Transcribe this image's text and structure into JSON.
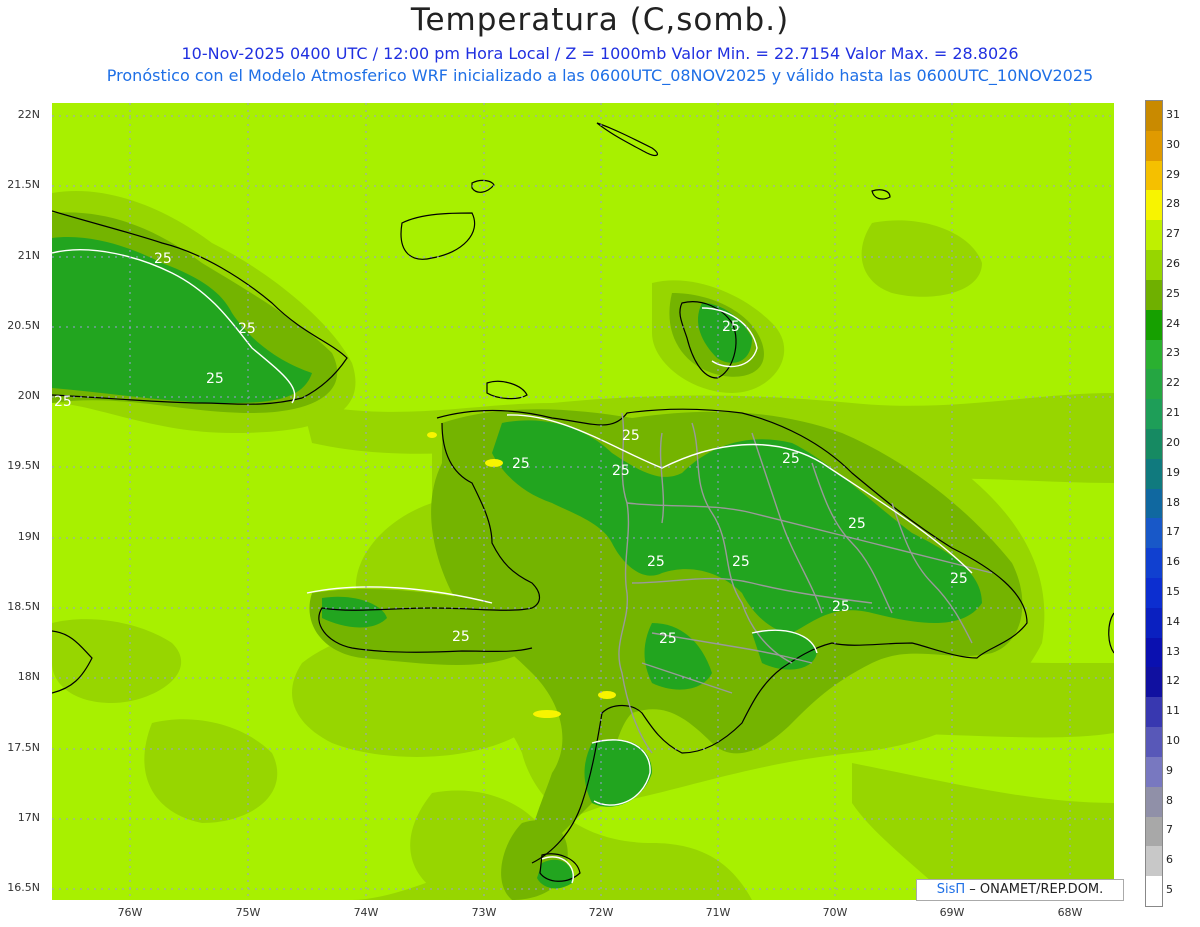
{
  "header": {
    "title": "Temperatura (C,somb.)",
    "subtitle_line1": "10-Nov-2025 0400 UTC / 12:00 pm Hora Local / Z = 1000mb   Valor Min. = 22.7154  Valor Max. = 28.8026",
    "subtitle_line2": "Pronóstico con el Modelo Atmosferico WRF inicializado a las 0600UTC_08NOV2025 y válido hasta las  0600UTC_10NOV2025"
  },
  "axes": {
    "lat_labels": [
      "22N",
      "21.5N",
      "21N",
      "20.5N",
      "20N",
      "19.5N",
      "19N",
      "18.5N",
      "18N",
      "17.5N",
      "17N",
      "16.5N"
    ],
    "lon_labels": [
      "76W",
      "75W",
      "74W",
      "73W",
      "72W",
      "71W",
      "70W",
      "69W",
      "68W"
    ]
  },
  "legend": {
    "values": [
      "31",
      "30",
      "29",
      "28",
      "27",
      "26",
      "25",
      "24",
      "23",
      "22",
      "21",
      "20",
      "19",
      "18",
      "17",
      "16",
      "15",
      "14",
      "13",
      "12",
      "11",
      "10",
      "9",
      "8",
      "7",
      "6",
      "5"
    ],
    "colors": [
      "#c98a00",
      "#e09a00",
      "#f5c000",
      "#f8f400",
      "#bff000",
      "#97d600",
      "#6fb000",
      "#16a000",
      "#2ab030",
      "#25a642",
      "#1e9e58",
      "#168a62",
      "#107a7e",
      "#1068a0",
      "#1858c8",
      "#1040d0",
      "#0c2ed0",
      "#0a20c0",
      "#0a10b0",
      "#1010a0",
      "#3838b0",
      "#5858b8",
      "#7878c0",
      "#9090a8",
      "#a8a8a8",
      "#c8c8c8",
      "#ffffff"
    ]
  },
  "map": {
    "contour_label": "25",
    "colors": {
      "c27": "#a8f000",
      "c26": "#97d600",
      "c25": "#74b400",
      "c24": "#22a51f",
      "c28": "#f8f400",
      "coast": "#000000",
      "border": "#9a9a9a",
      "grid": "#9a9ad8"
    }
  },
  "credit": {
    "brand": "SisΠ",
    "text": " – ONAMET/REP.DOM."
  }
}
